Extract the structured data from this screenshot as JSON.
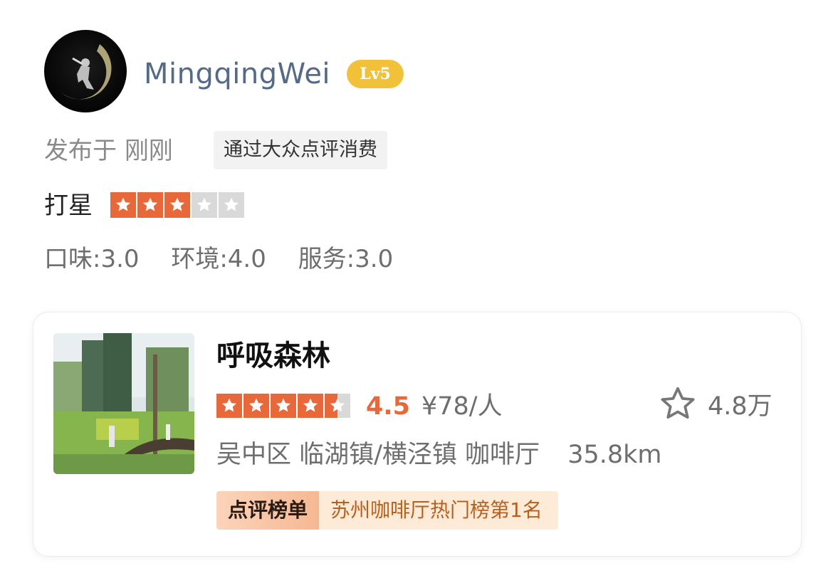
{
  "user": {
    "name": "MingqingWei",
    "level": "Lv5"
  },
  "post": {
    "posted_prefix": "发布于",
    "posted_time": "刚刚",
    "source_tag": "通过大众点评消费"
  },
  "rating": {
    "label": "打星",
    "stars": 3,
    "max_stars": 5,
    "subscores": [
      {
        "label": "口味:3.0"
      },
      {
        "label": "环境:4.0"
      },
      {
        "label": "服务:3.0"
      }
    ]
  },
  "shop": {
    "name": "呼吸森林",
    "stars": 4.5,
    "score": "4.5",
    "price": "¥78/人",
    "favorites": "4.8万",
    "location": "吴中区 临湖镇/横泾镇 咖啡厅",
    "distance": "35.8km",
    "rank_badge": "点评榜单",
    "rank_text": "苏州咖啡厅热门榜第1名"
  },
  "colors": {
    "star_active": "#e8683a",
    "star_inactive": "#d9d9d9",
    "level_badge": "#f1c13a",
    "username": "#556a86"
  }
}
